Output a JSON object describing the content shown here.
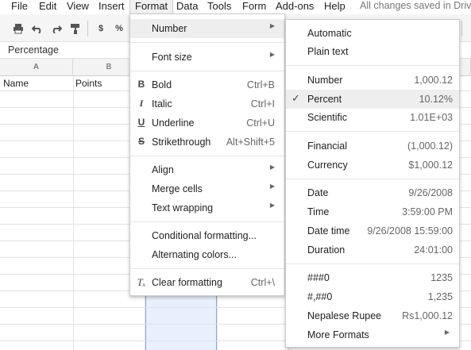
{
  "menubar": {
    "items": [
      "File",
      "Edit",
      "View",
      "Insert",
      "Format",
      "Data",
      "Tools",
      "Form",
      "Add-ons",
      "Help"
    ],
    "status": "All changes saved in Drive"
  },
  "toolbar": {
    "currency_label": "$",
    "percent_label": "%"
  },
  "formula_bar": {
    "value": "Percentage"
  },
  "grid": {
    "columns": [
      "A",
      "B"
    ],
    "headers": {
      "A": "Name",
      "B": "Points"
    }
  },
  "format_menu": {
    "number": "Number",
    "font_size": "Font size",
    "bold": {
      "label": "Bold",
      "shortcut": "Ctrl+B"
    },
    "italic": {
      "label": "Italic",
      "shortcut": "Ctrl+I"
    },
    "underline": {
      "label": "Underline",
      "shortcut": "Ctrl+U"
    },
    "strikethrough": {
      "label": "Strikethrough",
      "shortcut": "Alt+Shift+5"
    },
    "align": "Align",
    "merge_cells": "Merge cells",
    "text_wrapping": "Text wrapping",
    "conditional": "Conditional formatting...",
    "alternating": "Alternating colors...",
    "clear": {
      "label": "Clear formatting",
      "shortcut": "Ctrl+\\"
    }
  },
  "number_submenu": {
    "automatic": "Automatic",
    "plain_text": "Plain text",
    "number": {
      "label": "Number",
      "value": "1,000.12"
    },
    "percent": {
      "label": "Percent",
      "value": "10.12%"
    },
    "scientific": {
      "label": "Scientific",
      "value": "1.01E+03"
    },
    "financial": {
      "label": "Financial",
      "value": "(1,000.12)"
    },
    "currency": {
      "label": "Currency",
      "value": "$1,000.12"
    },
    "date": {
      "label": "Date",
      "value": "9/26/2008"
    },
    "time": {
      "label": "Time",
      "value": "3:59:00 PM"
    },
    "date_time": {
      "label": "Date time",
      "value": "9/26/2008 15:59:00"
    },
    "duration": {
      "label": "Duration",
      "value": "24:01:00"
    },
    "custom1": {
      "label": "###0",
      "value": "1235"
    },
    "custom2": {
      "label": "#,##0",
      "value": "1,235"
    },
    "rupee": {
      "label": "Nepalese Rupee",
      "value": "Rs1,000.12"
    },
    "more": "More Formats"
  }
}
